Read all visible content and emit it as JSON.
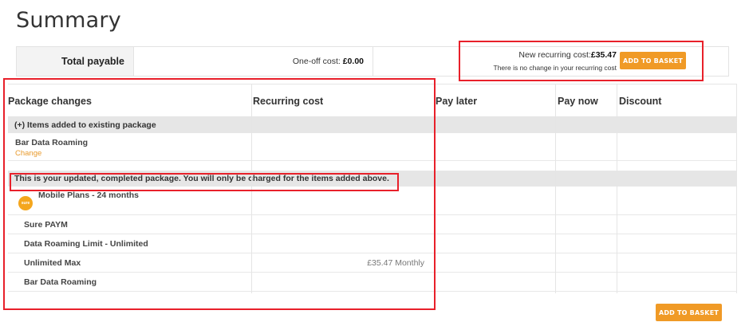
{
  "page": {
    "title": "Summary"
  },
  "summary": {
    "total_label": "Total payable",
    "oneoff_label": "One-off cost:",
    "oneoff_value": "£0.00",
    "recurring_label": "New recurring cost:",
    "recurring_value": "£35.47",
    "recurring_note": "There is no change in your recurring cost",
    "add_basket_label": "ADD TO BASKET"
  },
  "table": {
    "headers": [
      "Package changes",
      "Recurring cost",
      "Pay later",
      "Pay now",
      "Discount"
    ],
    "sections": [
      {
        "title": "(+) Items added to existing package",
        "rows": [
          {
            "label": "Bar Data Roaming",
            "link": "Change",
            "recurring": ""
          }
        ]
      },
      {
        "title": "This is your updated, completed package. You will only be charged for the items added above.",
        "rows": [
          {
            "label": "Mobile Plans - 24 months",
            "logo": "sure",
            "recurring": ""
          },
          {
            "label": "Sure PAYM",
            "recurring": ""
          },
          {
            "label": "Data Roaming Limit - Unlimited",
            "recurring": ""
          },
          {
            "label": "Unlimited Max",
            "recurring": "£35.47 Monthly"
          },
          {
            "label": "Bar Data Roaming",
            "recurring": ""
          }
        ]
      }
    ]
  },
  "footer": {
    "add_basket_label": "ADD TO BASKET"
  },
  "colors": {
    "accent": "#f09a26",
    "highlight": "#e8202a",
    "section_bg": "#e6e6e6"
  }
}
